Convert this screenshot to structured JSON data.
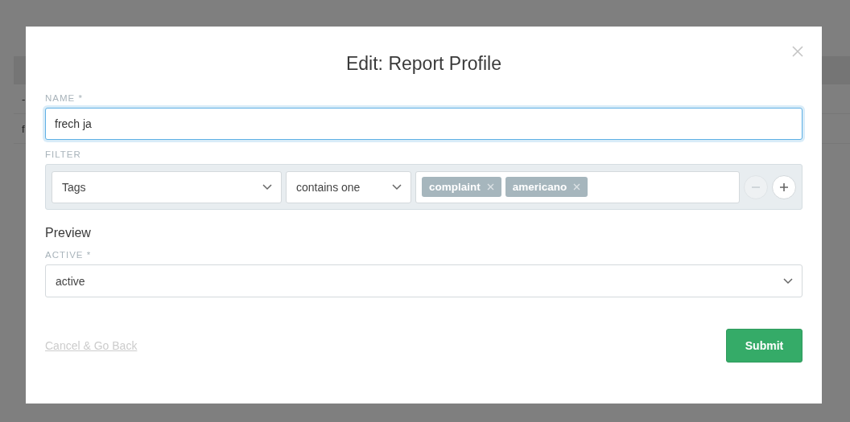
{
  "page": {
    "table": {
      "rows": [
        [
          "-"
        ],
        [
          "f"
        ]
      ]
    }
  },
  "dialog": {
    "title": "Edit: Report Profile",
    "name": {
      "label": "NAME *",
      "value": "frech ja",
      "focused": true
    },
    "filter": {
      "label": "FILTER",
      "attribute": "Tags",
      "operator": "contains one",
      "tags": [
        {
          "label": "complaint"
        },
        {
          "label": "americano"
        }
      ],
      "remove_disabled": true
    },
    "preview": "Preview",
    "active": {
      "label": "ACTIVE *",
      "value": "active"
    },
    "cancel": "Cancel & Go Back",
    "submit": "Submit"
  }
}
